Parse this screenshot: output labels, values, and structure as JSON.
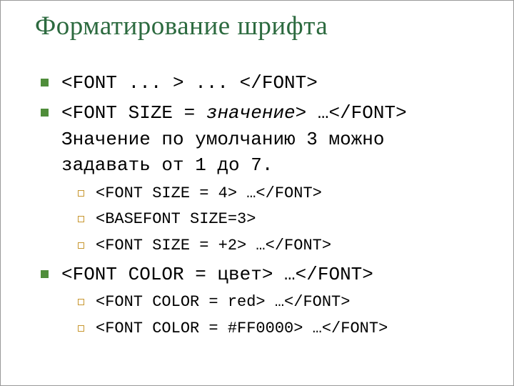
{
  "title": "Форматирование шрифта",
  "items": {
    "a": "<FONT ... > ... </FONT>",
    "b_part1": "<FONT SIZE = ",
    "b_italic": "значение",
    "b_part2": "> …</FONT> Значение по умолчанию 3 можно задавать от 1 до 7.",
    "b1": "<FONT SIZE = 4> …</FONT>",
    "b2": "<BASEFONT SIZE=3>",
    "b3": "<FONT SIZE = +2> …</FONT>",
    "c": "<FONT COLOR = цвет> …</FONT>",
    "c1": "<FONT COLOR = red> …</FONT>",
    "c2": "<FONT COLOR = #FF0000> …</FONT>"
  }
}
